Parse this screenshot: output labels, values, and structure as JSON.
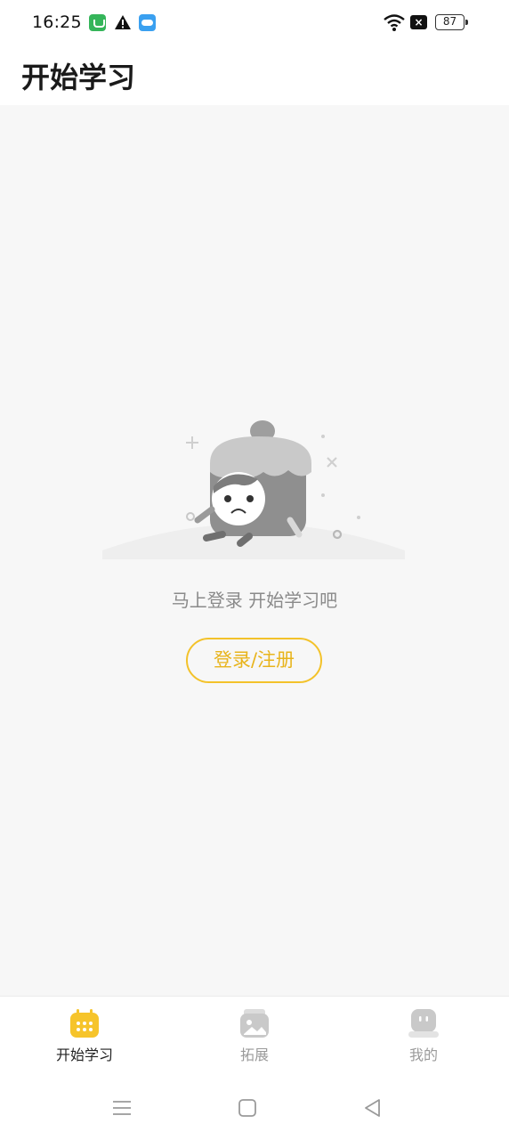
{
  "status_bar": {
    "time": "16:25",
    "battery": "87",
    "icons": [
      "wechat-app-icon",
      "warning-icon",
      "cloud-app-icon",
      "wifi-icon",
      "no-sim-icon",
      "battery-icon"
    ]
  },
  "header": {
    "title": "开始学习"
  },
  "empty_state": {
    "message": "马上登录 开始学习吧",
    "button_label": "登录/注册",
    "illustration": "sad-cartoon-character-illustration"
  },
  "bottom_nav": {
    "items": [
      {
        "label": "开始学习",
        "icon": "calendar-icon",
        "active": true
      },
      {
        "label": "拓展",
        "icon": "image-card-icon",
        "active": false
      },
      {
        "label": "我的",
        "icon": "robot-face-icon",
        "active": false
      }
    ]
  },
  "system_nav": {
    "icons": [
      "menu-icon",
      "home-square-icon",
      "back-triangle-icon"
    ]
  },
  "colors": {
    "accent": "#f3c22a",
    "accent_text": "#e8b41c",
    "background": "#f7f7f7",
    "inactive": "#9a9a9a"
  }
}
